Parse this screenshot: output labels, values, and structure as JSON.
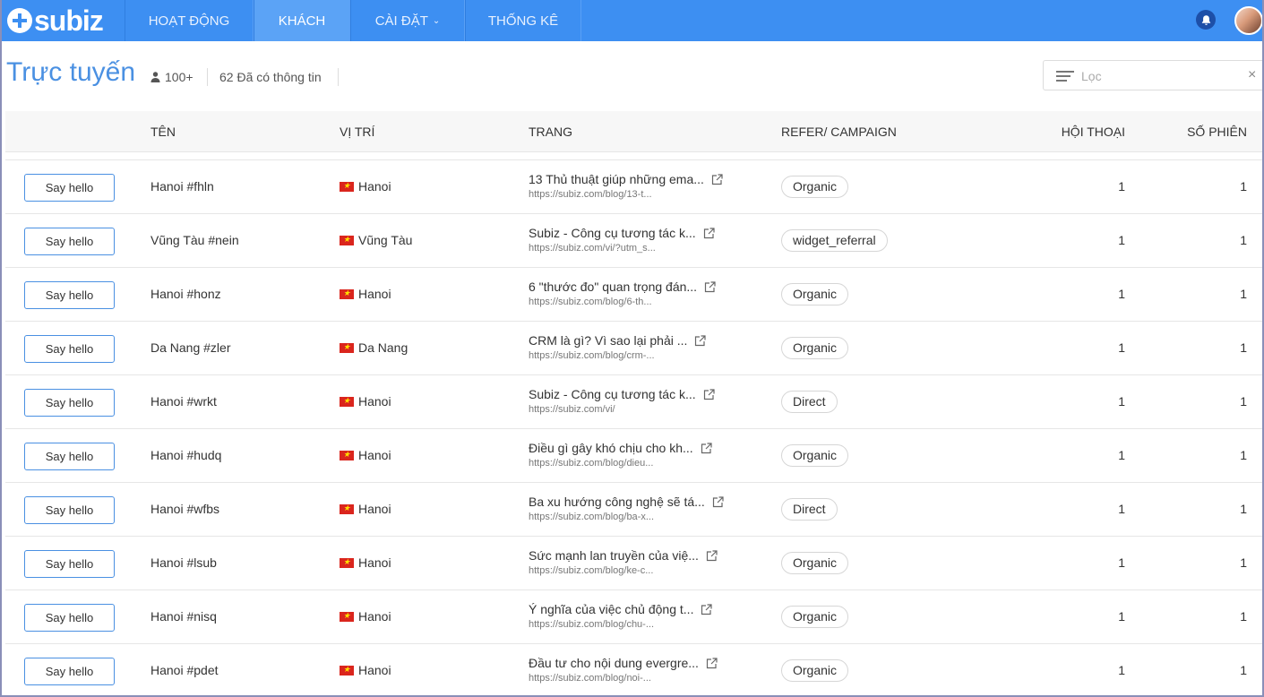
{
  "brand": {
    "logo_text": "subiz"
  },
  "nav": {
    "items": [
      {
        "label": "HOẠT ĐỘNG"
      },
      {
        "label": "KHÁCH"
      },
      {
        "label": "CÀI ĐẶT"
      },
      {
        "label": "THỐNG KÊ"
      }
    ],
    "active": "KHÁCH",
    "accent_color": "#3d8ff2"
  },
  "header": {
    "title": "Trực tuyến",
    "users_count": "100+",
    "info_count": "62 Đã có thông tin",
    "filter_placeholder": "Lọc",
    "clear_glyph": "×"
  },
  "table": {
    "columns": {
      "name": "TÊN",
      "location": "VỊ TRÍ",
      "page": "TRANG",
      "refer": "REFER/ CAMPAIGN",
      "conversations": "HỘI THOẠI",
      "sessions": "SỐ PHIÊN"
    },
    "button_label": "Say hello",
    "rows": [
      {
        "name": "Hanoi #fhln",
        "location": "Hanoi",
        "page_title": "13 Thủ thuật giúp những ema...",
        "page_url": "https://subiz.com/blog/13-t...",
        "refer": "Organic",
        "conversations": "1",
        "sessions": "1"
      },
      {
        "name": "Vũng Tàu #nein",
        "location": "Vũng Tàu",
        "page_title": "Subiz - Công cụ tương tác k...",
        "page_url": "https://subiz.com/vi/?utm_s...",
        "refer": "widget_referral",
        "conversations": "1",
        "sessions": "1"
      },
      {
        "name": "Hanoi #honz",
        "location": "Hanoi",
        "page_title": "6 \"thước đo\" quan trọng đán...",
        "page_url": "https://subiz.com/blog/6-th...",
        "refer": "Organic",
        "conversations": "1",
        "sessions": "1"
      },
      {
        "name": "Da Nang #zler",
        "location": "Da Nang",
        "page_title": "CRM là gì? Vì sao lại phải ...",
        "page_url": "https://subiz.com/blog/crm-...",
        "refer": "Organic",
        "conversations": "1",
        "sessions": "1"
      },
      {
        "name": "Hanoi #wrkt",
        "location": "Hanoi",
        "page_title": "Subiz - Công cụ tương tác k...",
        "page_url": "https://subiz.com/vi/",
        "refer": "Direct",
        "conversations": "1",
        "sessions": "1"
      },
      {
        "name": "Hanoi #hudq",
        "location": "Hanoi",
        "page_title": "Điều gì gây khó chịu cho kh...",
        "page_url": "https://subiz.com/blog/dieu...",
        "refer": "Organic",
        "conversations": "1",
        "sessions": "1"
      },
      {
        "name": "Hanoi #wfbs",
        "location": "Hanoi",
        "page_title": "Ba xu hướng công nghệ sẽ tá...",
        "page_url": "https://subiz.com/blog/ba-x...",
        "refer": "Direct",
        "conversations": "1",
        "sessions": "1"
      },
      {
        "name": "Hanoi #lsub",
        "location": "Hanoi",
        "page_title": "Sức mạnh lan truyền của việ...",
        "page_url": "https://subiz.com/blog/ke-c...",
        "refer": "Organic",
        "conversations": "1",
        "sessions": "1"
      },
      {
        "name": "Hanoi #nisq",
        "location": "Hanoi",
        "page_title": "Ý nghĩa của việc chủ động t...",
        "page_url": "https://subiz.com/blog/chu-...",
        "refer": "Organic",
        "conversations": "1",
        "sessions": "1"
      },
      {
        "name": "Hanoi #pdet",
        "location": "Hanoi",
        "page_title": "Đầu tư cho nội dung evergre...",
        "page_url": "https://subiz.com/blog/noi-...",
        "refer": "Organic",
        "conversations": "1",
        "sessions": "1"
      }
    ]
  },
  "icons": [
    "plus-logo-icon",
    "chevron-down-icon",
    "bell-icon",
    "avatar",
    "user-icon",
    "filter-lines-icon",
    "close-icon",
    "vietnam-flag-icon",
    "external-link-icon"
  ]
}
